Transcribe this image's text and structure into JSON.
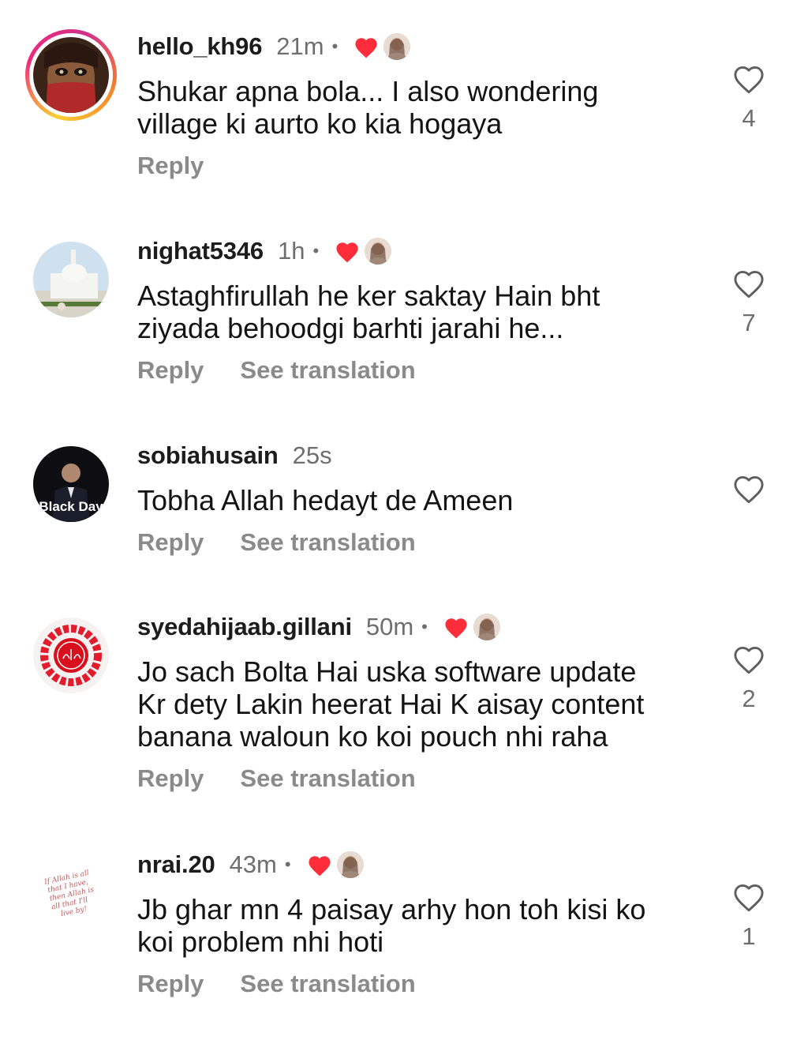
{
  "colors": {
    "heart_red": "#ff2d3a",
    "secondary_text": "#6e6e6e",
    "action_text": "#8a8a8a",
    "story_ring": [
      "#f9ce34",
      "#ee2a7b",
      "#f58529"
    ]
  },
  "comments": [
    {
      "username": "hello_kh96",
      "time": "21m",
      "separator": "•",
      "liked_by_author": true,
      "text": "Shukar apna bola... I also wondering\nvillage ki aurto ko kia hogaya",
      "reply_label": "Reply",
      "translation_label": "",
      "like_count": "4",
      "avatar_icon": "woman-veil-avatar",
      "has_story_ring": true
    },
    {
      "username": "nighat5346",
      "time": "1h",
      "separator": "•",
      "liked_by_author": true,
      "text": "Astaghfirullah he ker saktay Hain bht\nziyada behoodgi barhti jarahi he...",
      "reply_label": "Reply",
      "translation_label": "See translation",
      "like_count": "7",
      "avatar_icon": "mosque-avatar",
      "has_story_ring": false
    },
    {
      "username": "sobiahusain",
      "time": "25s",
      "separator": "",
      "liked_by_author": false,
      "text": "Tobha Allah hedayt de Ameen",
      "reply_label": "Reply",
      "translation_label": "See translation",
      "like_count": "",
      "avatar_icon": "black-day-avatar",
      "avatar_text": "Black Day",
      "has_story_ring": false
    },
    {
      "username": "syedahijaab.gillani",
      "time": "50m",
      "separator": "•",
      "liked_by_author": true,
      "text": "Jo sach Bolta Hai uska software update\nKr dety Lakin heerat Hai K aisay content\nbanana waloun ko koi pouch nhi raha",
      "reply_label": "Reply",
      "translation_label": "See translation",
      "like_count": "2",
      "avatar_icon": "calligraphy-roses-avatar",
      "has_story_ring": false
    },
    {
      "username": "nrai.20",
      "time": "43m",
      "separator": "•",
      "liked_by_author": true,
      "text": "Jb ghar mn 4 paisay arhy hon toh kisi ko\nkoi problem nhi hoti",
      "reply_label": "Reply",
      "translation_label": "See translation",
      "like_count": "1",
      "avatar_icon": "handwritten-quote-avatar",
      "avatar_text": "If Allah is all that I have, then Allah is all that I'll live by!",
      "has_story_ring": false
    }
  ]
}
